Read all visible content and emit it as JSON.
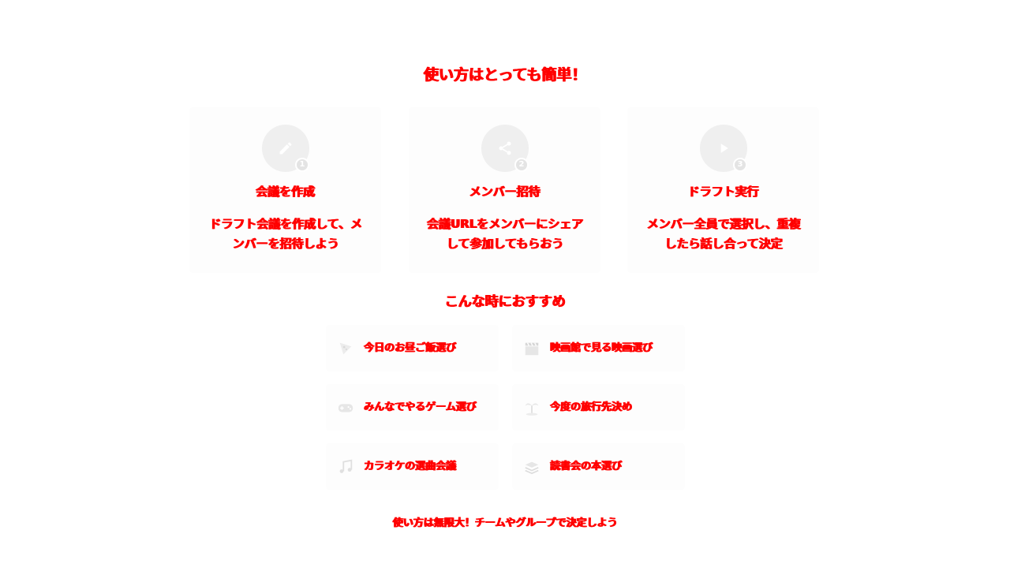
{
  "main_title": "使い方はとっても簡単！",
  "steps": [
    {
      "number": "1",
      "icon": "pencil-icon",
      "title": "会議を作成",
      "description": "ドラフト会議を作成して、メンバーを招待しよう"
    },
    {
      "number": "2",
      "icon": "share-icon",
      "title": "メンバー招待",
      "description": "会議URLをメンバーにシェアして参加してもらおう"
    },
    {
      "number": "3",
      "icon": "play-icon",
      "title": "ドラフト実行",
      "description": "メンバー全員で選択し、重複したら話し合って決定"
    }
  ],
  "recommend_title": "こんな時におすすめ",
  "use_cases": [
    {
      "icon": "pizza-icon",
      "label": "今日のお昼ご飯選び"
    },
    {
      "icon": "clapperboard-icon",
      "label": "映画館で見る映画選び"
    },
    {
      "icon": "gamepad-icon",
      "label": "みんなでやるゲーム選び"
    },
    {
      "icon": "palm-tree-icon",
      "label": "今度の旅行先決め"
    },
    {
      "icon": "music-note-icon",
      "label": "カラオケの選曲会議"
    },
    {
      "icon": "books-icon",
      "label": "読書会の本選び"
    }
  ],
  "footer": "使い方は無限大！チームやグループで決定しよう",
  "colors": {
    "text": "#ff0000",
    "card_bg": "#fdfdfd",
    "icon_bg": "#efefef",
    "icon_fg": "#ffffff"
  }
}
